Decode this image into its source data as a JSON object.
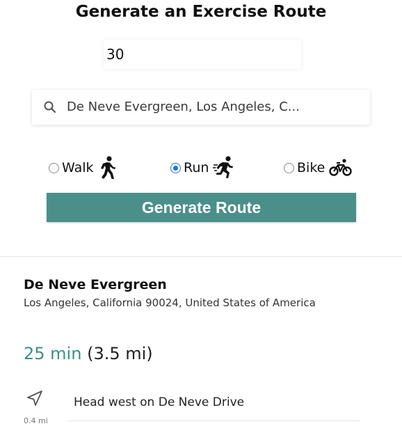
{
  "form": {
    "title": "Generate an Exercise Route",
    "minutes_value": "30",
    "search_value": "De Neve Evergreen, Los Angeles, C...",
    "modes": [
      {
        "label": "Walk",
        "selected": false,
        "icon": "walk-icon"
      },
      {
        "label": "Run",
        "selected": true,
        "icon": "run-icon"
      },
      {
        "label": "Bike",
        "selected": false,
        "icon": "bike-icon"
      }
    ],
    "generate_label": "Generate Route",
    "accent_color": "#4a8f8a"
  },
  "result": {
    "place_name": "De Neve Evergreen",
    "place_address": "Los Angeles, California 90024, United States of America",
    "duration": "25 min",
    "distance": "(3.5 mi)",
    "steps": [
      {
        "icon": "navigation-arrow-icon",
        "instruction": "Head west on De Neve Drive",
        "distance": "0.4 mi"
      }
    ]
  }
}
